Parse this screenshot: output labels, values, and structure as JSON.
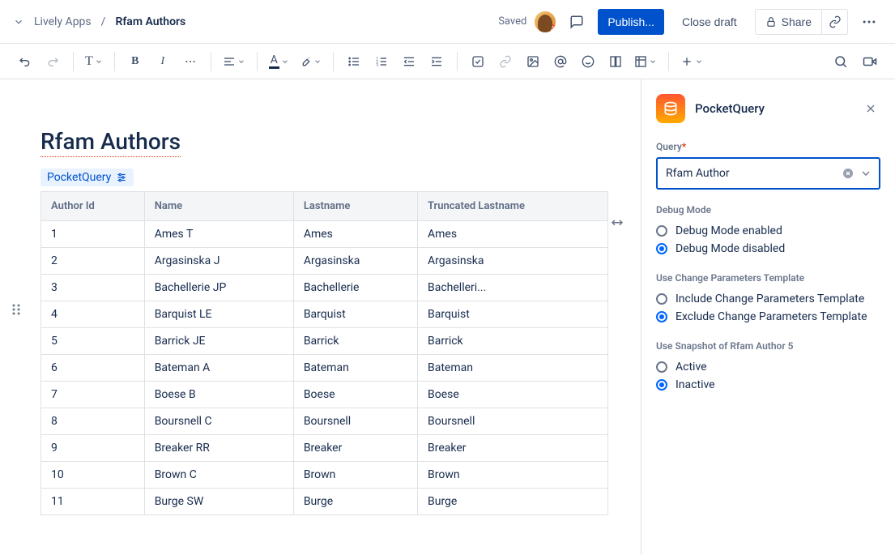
{
  "breadcrumb": {
    "parent": "Lively Apps",
    "title": "Rfam Authors"
  },
  "header": {
    "saved": "Saved",
    "publish": "Publish...",
    "closeDraft": "Close draft",
    "share": "Share"
  },
  "doc": {
    "title": "Rfam Authors",
    "macroChip": "PocketQuery"
  },
  "table": {
    "columns": [
      "Author Id",
      "Name",
      "Lastname",
      "Truncated Lastname"
    ],
    "rows": [
      [
        "1",
        "Ames T",
        "Ames",
        "Ames"
      ],
      [
        "2",
        "Argasinska J",
        "Argasinska",
        "Argasinska"
      ],
      [
        "3",
        "Bachellerie JP",
        "Bachellerie",
        "Bachelleri..."
      ],
      [
        "4",
        "Barquist LE",
        "Barquist",
        "Barquist"
      ],
      [
        "5",
        "Barrick JE",
        "Barrick",
        "Barrick"
      ],
      [
        "6",
        "Bateman A",
        "Bateman",
        "Bateman"
      ],
      [
        "7",
        "Boese B",
        "Boese",
        "Boese"
      ],
      [
        "8",
        "Boursnell C",
        "Boursnell",
        "Boursnell"
      ],
      [
        "9",
        "Breaker RR",
        "Breaker",
        "Breaker"
      ],
      [
        "10",
        "Brown C",
        "Brown",
        "Brown"
      ],
      [
        "11",
        "Burge SW",
        "Burge",
        "Burge"
      ]
    ]
  },
  "panel": {
    "appName": "PocketQuery",
    "queryLabel": "Query",
    "queryValue": "Rfam Author",
    "debug": {
      "label": "Debug Mode",
      "enabled": "Debug Mode enabled",
      "disabled": "Debug Mode disabled"
    },
    "changeParams": {
      "label": "Use Change Parameters Template",
      "include": "Include Change Parameters Template",
      "exclude": "Exclude Change Parameters Template"
    },
    "snapshot": {
      "label": "Use Snapshot of Rfam Author 5",
      "active": "Active",
      "inactive": "Inactive"
    }
  }
}
